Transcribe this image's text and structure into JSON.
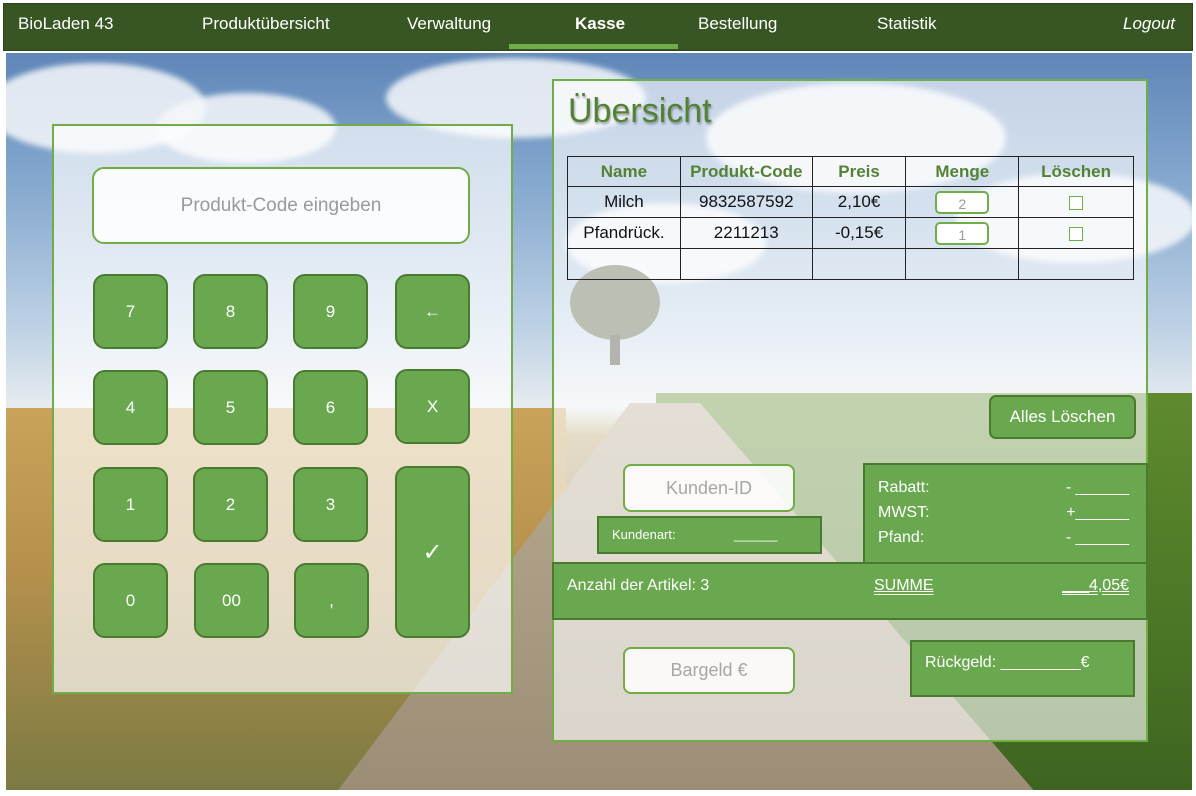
{
  "nav": {
    "brand": "BioLaden 43",
    "items": [
      "Produktübersicht",
      "Verwaltung",
      "Kasse",
      "Bestellung",
      "Statistik"
    ],
    "active": "Kasse",
    "logout": "Logout"
  },
  "keypad": {
    "input_placeholder": "Produkt-Code eingeben",
    "keys": {
      "k7": "7",
      "k8": "8",
      "k9": "9",
      "back": "←",
      "k4": "4",
      "k5": "5",
      "k6": "6",
      "clear": "X",
      "k1": "1",
      "k2": "2",
      "k3": "3",
      "enter": "✓",
      "k0": "0",
      "k00": "00",
      "comma": ","
    }
  },
  "overview": {
    "title": "Übersicht",
    "columns": [
      "Name",
      "Produkt-Code",
      "Preis",
      "Menge",
      "Löschen"
    ],
    "rows": [
      {
        "name": "Milch",
        "code": "9832587592",
        "price": "2,10€",
        "qty": "2"
      },
      {
        "name": "Pfandrück.",
        "code": "2211213",
        "price": "-0,15€",
        "qty": "1"
      }
    ],
    "clear_all": "Alles Löschen"
  },
  "customer": {
    "id_placeholder": "Kunden-ID",
    "type_label": "Kundenart:",
    "type_value": "______"
  },
  "totals": {
    "discount_label": "Rabatt:",
    "discount_value": "- ______",
    "vat_label": "MWST:",
    "vat_value": "+______",
    "deposit_label": "Pfand:",
    "deposit_value": "- ______"
  },
  "summary": {
    "count_text": "Anzahl der Artikel: 3",
    "sum_label": "SUMME",
    "sum_value": "___4,05€"
  },
  "payment": {
    "cash_placeholder": "Bargeld €",
    "change_text": "Rückgeld: _________€"
  },
  "colors": {
    "nav_bg": "#375623",
    "accent": "#70ad47",
    "button": "#6aa84f",
    "title": "#548235"
  }
}
